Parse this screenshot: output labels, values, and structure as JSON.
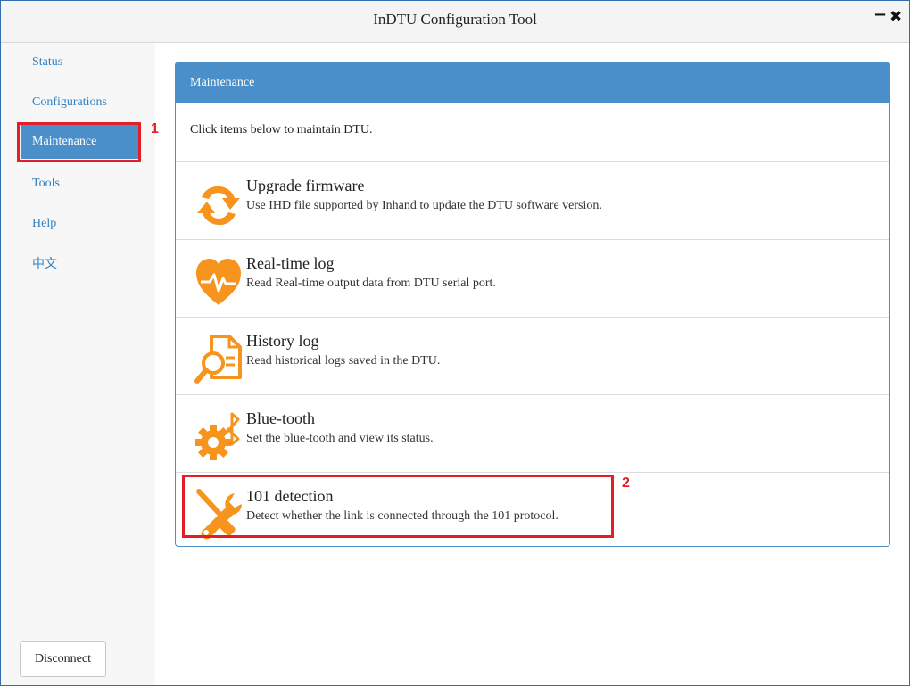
{
  "window": {
    "title": "InDTU Configuration Tool",
    "minimize_label": "−",
    "close_label": "✖"
  },
  "sidebar": {
    "items": [
      {
        "label": "Status"
      },
      {
        "label": "Configurations"
      },
      {
        "label": "Maintenance",
        "active": true
      },
      {
        "label": "Tools"
      },
      {
        "label": "Help"
      },
      {
        "label": "中文"
      }
    ],
    "disconnect_label": "Disconnect"
  },
  "panel": {
    "header": "Maintenance",
    "intro": "Click items below to maintain DTU.",
    "items": [
      {
        "title": "Upgrade firmware",
        "desc": "Use IHD file supported by Inhand to update the DTU software version.",
        "icon": "refresh-icon"
      },
      {
        "title": "Real-time log",
        "desc": "Read Real-time output data from DTU serial port.",
        "icon": "heartbeat-icon"
      },
      {
        "title": "History log",
        "desc": "Read historical logs saved in the DTU.",
        "icon": "document-search-icon"
      },
      {
        "title": "Blue-tooth",
        "desc": "Set the blue-tooth and view its status.",
        "icon": "bluetooth-gear-icon"
      },
      {
        "title": "101 detection",
        "desc": "Detect whether the link is connected through the 101 protocol.",
        "icon": "wrench-screwdriver-icon"
      }
    ]
  },
  "annotations": {
    "first": "1",
    "second": "2",
    "color": "#e41e26"
  },
  "colors": {
    "accent": "#4a8fc9",
    "icon": "#f7941d",
    "link": "#2f7fc1"
  }
}
